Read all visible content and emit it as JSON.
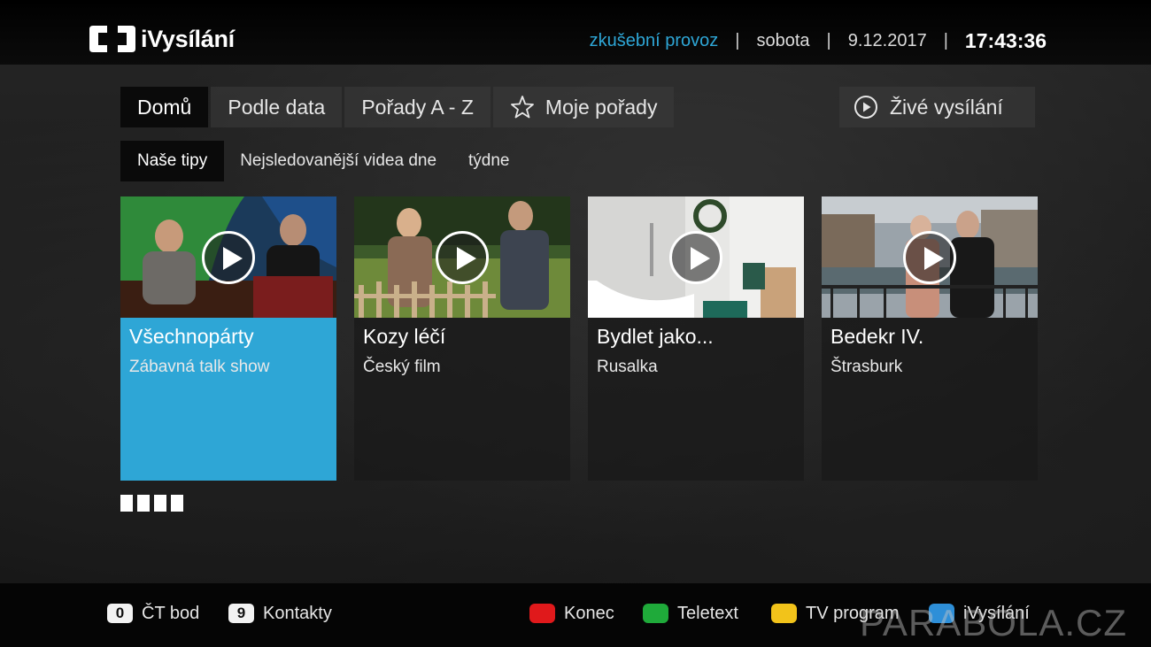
{
  "header": {
    "logo_text": "iVysílání",
    "mode": "zkušební provoz",
    "day": "sobota",
    "date": "9.12.2017",
    "time": "17:43:36",
    "accent_color": "#2ea6d6"
  },
  "nav": {
    "tabs": [
      {
        "label": "Domů",
        "active": true
      },
      {
        "label": "Podle data"
      },
      {
        "label": "Pořady A - Z"
      },
      {
        "label": "Moje pořady",
        "icon": "star-icon"
      }
    ],
    "live": {
      "label": "Živé vysílání",
      "icon": "play-circle-icon"
    }
  },
  "subnav": {
    "tabs": [
      {
        "label": "Naše tipy",
        "active": true
      },
      {
        "label": "Nejsledovanější videa dne"
      },
      {
        "label": "týdne"
      }
    ]
  },
  "cards": [
    {
      "title": "Všechnopárty",
      "subtitle": "Zábavná talk show",
      "selected": true
    },
    {
      "title": "Kozy léčí",
      "subtitle": "Český film"
    },
    {
      "title": "Bydlet jako...",
      "subtitle": "Rusalka"
    },
    {
      "title": "Bedekr IV.",
      "subtitle": "Štrasburk"
    }
  ],
  "pager": {
    "pages": 4
  },
  "footer": {
    "hints": [
      {
        "key": "0",
        "label": "ČT bod"
      },
      {
        "key": "9",
        "label": "Kontakty"
      }
    ],
    "color_buttons": [
      {
        "color": "#e0191b",
        "label": "Konec"
      },
      {
        "color": "#1faa3a",
        "label": "Teletext"
      },
      {
        "color": "#f2c31a",
        "label": "TV program"
      },
      {
        "color": "#2e8fd8",
        "label": "iVysílání"
      }
    ]
  },
  "watermark": "PARABOLA.CZ"
}
